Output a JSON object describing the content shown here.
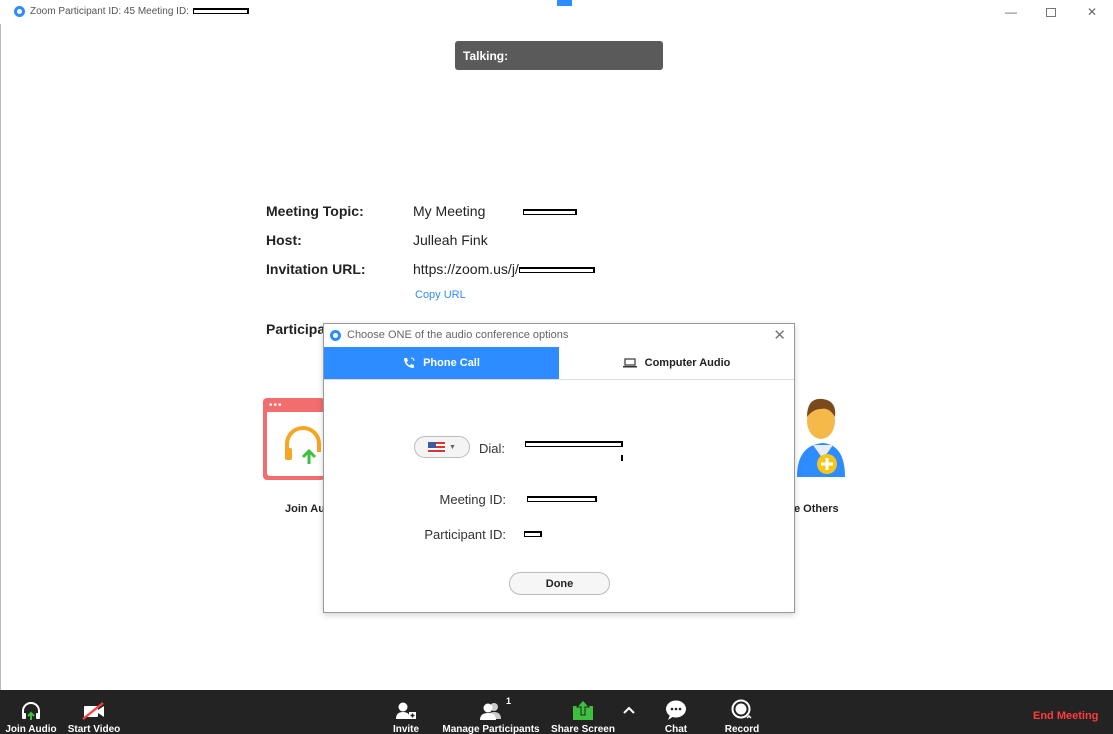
{
  "window": {
    "title": "Zoom Participant ID: 45   Meeting ID:"
  },
  "talking": {
    "label": "Talking:"
  },
  "meeting_info": {
    "topic_label": "Meeting Topic:",
    "topic_value": "My Meeting",
    "host_label": "Host:",
    "host_value": "Julleah Fink",
    "url_label": "Invitation URL:",
    "url_value": "https://zoom.us/j/",
    "copy_url": "Copy URL",
    "participant_label": "Participa"
  },
  "tiles": {
    "join_audio_label": "Join Au",
    "invite_label": "e Others"
  },
  "dialog": {
    "title": "Choose ONE of the audio conference options",
    "tabs": [
      {
        "label": "Phone Call",
        "active": true
      },
      {
        "label": "Computer Audio",
        "active": false
      }
    ],
    "dial_label": "Dial:",
    "meeting_id_label": "Meeting ID:",
    "participant_id_label": "Participant ID:",
    "done_label": "Done"
  },
  "toolbar": {
    "join_audio": "Join Audio",
    "start_video": "Start Video",
    "invite": "Invite",
    "manage_participants": "Manage Participants",
    "participants_count": "1",
    "share_screen": "Share Screen",
    "chat": "Chat",
    "record": "Record",
    "end_meeting": "End Meeting"
  },
  "colors": {
    "accent": "#2d8cff",
    "toolbar_bg": "#232323",
    "end_meeting": "#ff3b3b",
    "share_green": "#3dc13d"
  }
}
